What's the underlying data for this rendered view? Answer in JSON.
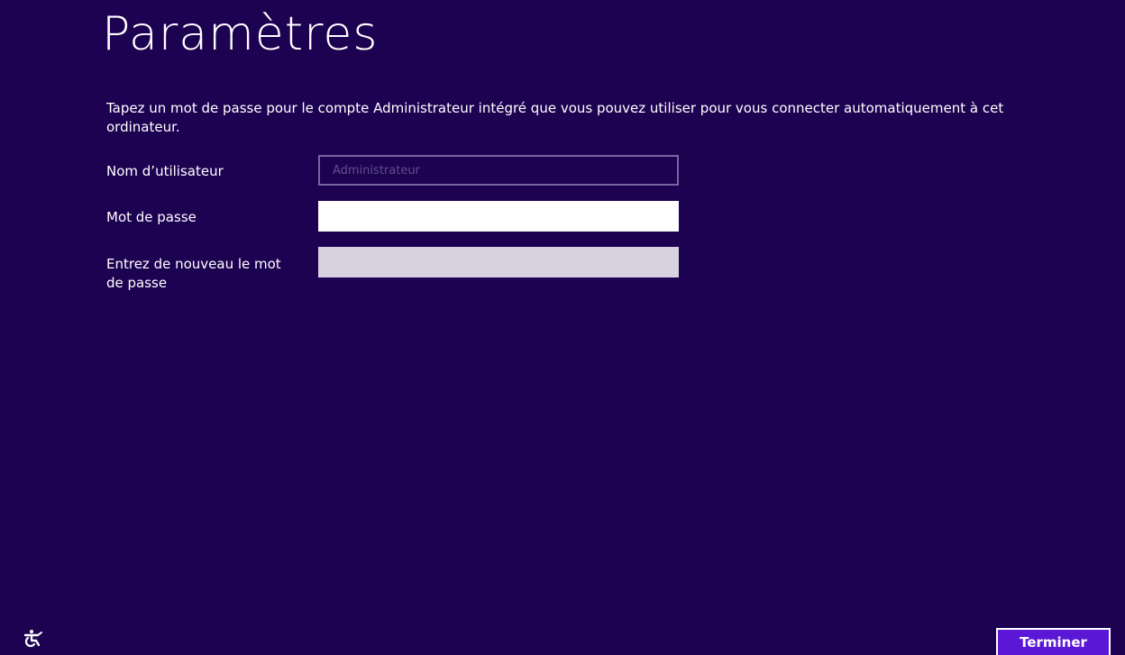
{
  "window": {
    "title": "Paramètres"
  },
  "colors": {
    "background": "#1e0252",
    "button": "#5b17d6",
    "disabled_field_border": "#7565a0",
    "confirm_field_fill": "#d7d2df"
  },
  "main": {
    "description": "Tapez un mot de passe pour le compte Administrateur intégré que vous pouvez utiliser pour vous connecter automatiquement à cet ordinateur.",
    "fields": {
      "username": {
        "label": "Nom d’utilisateur",
        "placeholder": "Administrateur",
        "value": ""
      },
      "password": {
        "label": "Mot de passe",
        "value": ""
      },
      "confirm": {
        "label": "Entrez de nouveau le mot de passe",
        "value": ""
      }
    }
  },
  "footer": {
    "accessibility_icon": "ease-of-access-icon",
    "finish_label": "Terminer"
  }
}
